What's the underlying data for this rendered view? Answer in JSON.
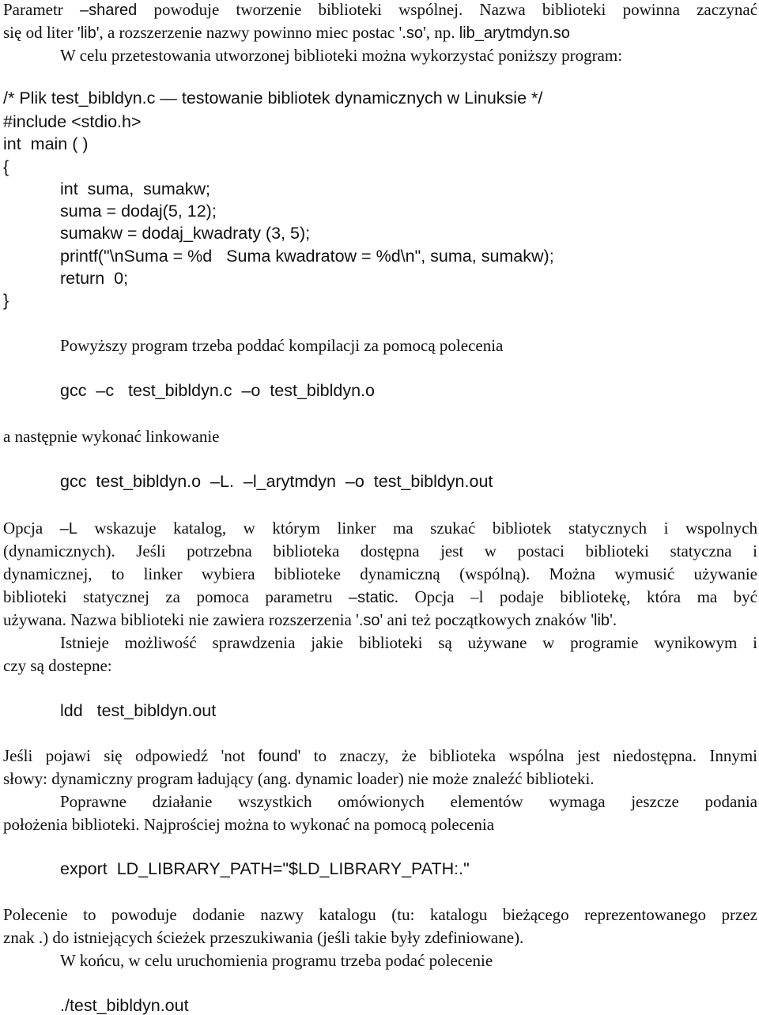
{
  "intro": {
    "line1_a": "Parametr ",
    "line1_opt": "–shared",
    "line1_b": " powoduje tworzenie biblioteki wspólnej. Nazwa biblioteki powinna zaczynać",
    "line2_a": "się od liter '",
    "line2_lib": "lib",
    "line2_b": "', a rozszerzenie nazwy powinno miec postac '",
    "line2_so": ".so",
    "line2_c": "', np. ",
    "line2_example": "lib_arytmdyn.so",
    "line3": "W celu przetestowania utworzonej biblioteki można wykorzystać poniższy program:"
  },
  "program": {
    "lines": [
      "/* Plik test_bibldyn.c — testowanie bibliotek dynamicznych w Linuksie */",
      "#include <stdio.h>",
      "int  main ( )",
      "{",
      "int  suma,  sumakw;",
      "suma = dodaj(5, 12);",
      "sumakw = dodaj_kwadraty (3, 5);",
      "printf(\"\\nSuma = %d   Suma kwadratow = %d\\n\", suma, sumakw);",
      "return  0;",
      "}"
    ]
  },
  "compile": {
    "intro": "Powyższy program trzeba poddać kompilacji za pomocą polecenia",
    "command": "gcc  –c   test_bibldyn.c  –o  test_bibldyn.o",
    "link_intro": "a następnie wykonać linkowanie",
    "link_command": "gcc  test_bibldyn.o  –L.  –l_arytmdyn  –o  test_bibldyn.out"
  },
  "options": {
    "p1_a": "Opcja ",
    "p1_L": "–L",
    "p1_b": " wskazuje katalog, w którym linker ma szukać bibliotek statycznych i wspolnych",
    "p2": "(dynamicznych). Jeśli potrzebna biblioteka dostępna jest w postaci biblioteki statyczna i",
    "p3": "dynamicznej, to linker wybiera biblioteke dynamiczną (wspólną). Można wymusić używanie",
    "p4_a": "biblioteki statycznej za pomoca parametru ",
    "p4_static": "–static",
    "p4_b": ". Opcja –l podaje bibliotekę, która ma być",
    "p5_a": "używana. Nazwa biblioteki nie zawiera rozszerzenia '",
    "p5_so": ".so",
    "p5_b": "' ani też początkowych znaków '",
    "p5_lib": "lib",
    "p5_c": "'."
  },
  "ldd": {
    "p1": "Istnieje możliwość sprawdzenia jakie biblioteki są używane w programie      wynikowym i",
    "p2": "czy są dostepne:",
    "command": "ldd   test_bibldyn.out",
    "nf_a": "Jeśli pojawi się odpowiedź  'not ",
    "nf_found": "found",
    "nf_b": "' to znaczy, że biblioteka wspólna jest niedostępna. Innymi",
    "nf_2": "słowy: dynamiczny program ładujący (ang. dynamic loader) nie może znaleźć biblioteki."
  },
  "path": {
    "p1": "Poprawne działanie wszystkich omówionych elementów wymaga jeszcze podania",
    "p2": "położenia biblioteki. Najprościej można to wykonać na pomocą polecenia",
    "command": "export  LD_LIBRARY_PATH=\"$LD_LIBRARY_PATH:.\"",
    "e1": "Polecenie to powoduje dodanie nazwy katalogu (tu: katalogu bieżącego reprezentowanego przez",
    "e2": "znak .) do istniejących ścieżek przeszukiwania (jeśli takie były zdefiniowane).",
    "run_intro": "W końcu, w celu uruchomienia programu trzeba podać polecenie",
    "run_command": "./test_bibldyn.out"
  }
}
